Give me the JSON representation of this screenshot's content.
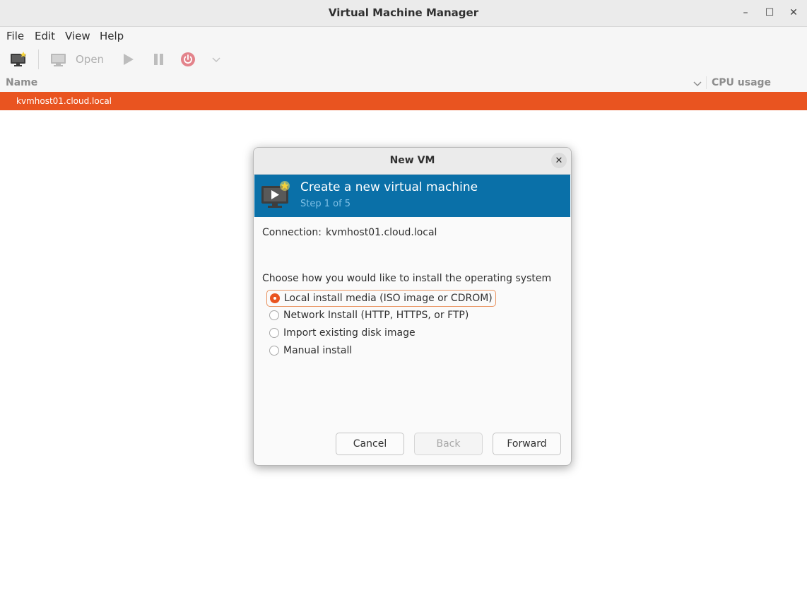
{
  "window": {
    "title": "Virtual Machine Manager",
    "controls": {
      "minimize": "–",
      "maximize": "☐",
      "close": "✕"
    }
  },
  "menubar": {
    "items": [
      "File",
      "Edit",
      "View",
      "Help"
    ]
  },
  "toolbar": {
    "open_label": "Open"
  },
  "list": {
    "columns": {
      "name": "Name",
      "cpu": "CPU usage"
    },
    "rows": [
      {
        "name": "kvmhost01.cloud.local",
        "selected": true
      }
    ]
  },
  "dialog": {
    "title": "New VM",
    "close": "✕",
    "banner": {
      "title": "Create a new virtual machine",
      "subtitle": "Step 1 of 5"
    },
    "connection": {
      "label": "Connection:",
      "value": "kvmhost01.cloud.local"
    },
    "prompt": "Choose how you would like to install the operating system",
    "options": [
      {
        "label": "Local install media (ISO image or CDROM)",
        "selected": true
      },
      {
        "label": "Network Install (HTTP, HTTPS, or FTP)",
        "selected": false
      },
      {
        "label": "Import existing disk image",
        "selected": false
      },
      {
        "label": "Manual install",
        "selected": false
      }
    ],
    "buttons": {
      "cancel": "Cancel",
      "back": "Back",
      "forward": "Forward"
    }
  },
  "colors": {
    "accent": "#e95420",
    "banner": "#0a70a8",
    "banner_subtitle": "#7fc0e6"
  },
  "icons": {
    "new_vm": "monitor-star-icon",
    "open": "monitor-icon",
    "run": "play-icon",
    "pause": "pause-icon",
    "shutdown": "power-icon",
    "shutdown_menu": "chevron-down-icon",
    "sort": "chevron-down-icon"
  }
}
